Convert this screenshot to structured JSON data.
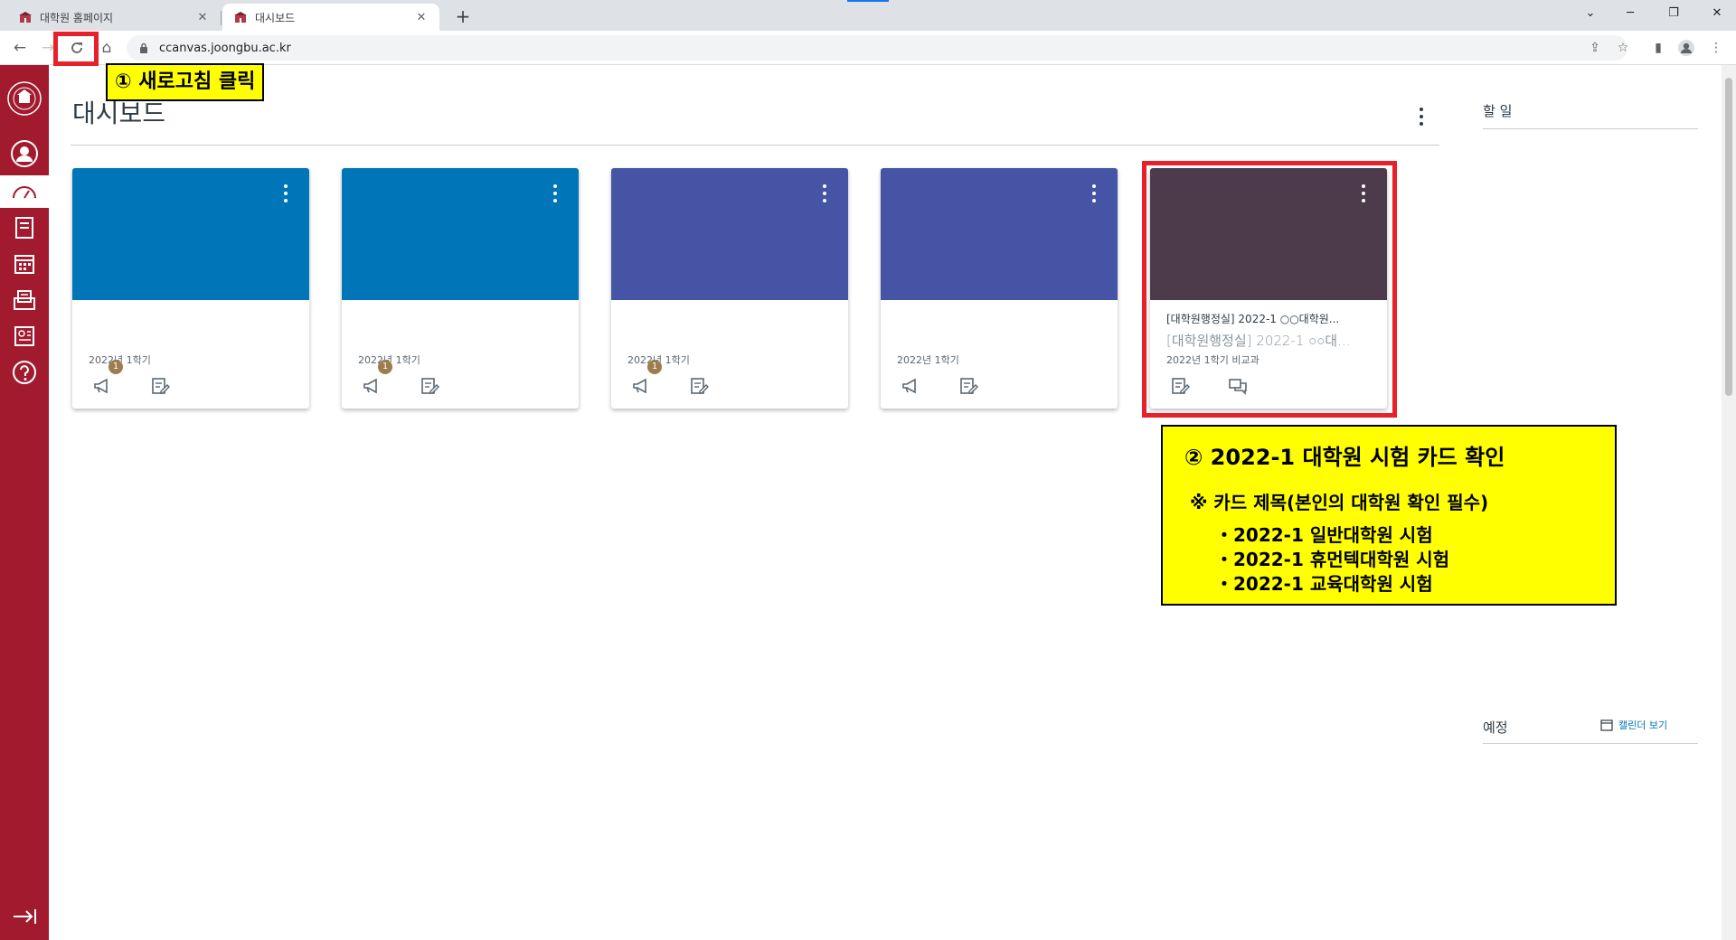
{
  "browser": {
    "tabs": [
      {
        "label": "대학원 홈페이지",
        "active": false
      },
      {
        "label": "대시보드",
        "active": true
      }
    ],
    "new_tab_label": "+",
    "close_label": "✕",
    "url": "ccanvas.joongbu.ac.kr"
  },
  "colors": {
    "nav_bg": "#a11a2e",
    "card_blue": "#0076b8",
    "card_indigo": "#4554a4",
    "card_plum": "#4d3b4b",
    "highlight_red": "#e8202a",
    "note_yellow": "#ffff00",
    "badge": "#9d7d4f"
  },
  "global_nav": {
    "items": [
      {
        "name": "account",
        "icon": "user-icon"
      },
      {
        "name": "dashboard",
        "icon": "dashboard-icon",
        "active": true
      },
      {
        "name": "courses",
        "icon": "book-icon"
      },
      {
        "name": "calendar",
        "icon": "calendar-icon"
      },
      {
        "name": "inbox",
        "icon": "inbox-icon"
      },
      {
        "name": "commons",
        "icon": "commons-icon"
      },
      {
        "name": "help",
        "icon": "help-icon"
      }
    ],
    "collapse_icon": "collapse-icon"
  },
  "dashboard": {
    "title": "대시보드",
    "cards": [
      {
        "color": "#0076b8",
        "title": "",
        "subtitle": "",
        "term": "2022년 1학기",
        "badge": "1",
        "icons": [
          "announcement-icon",
          "assignment-icon"
        ]
      },
      {
        "color": "#0076b8",
        "title": "",
        "subtitle": "",
        "term": "2022년 1학기",
        "badge": "1",
        "icons": [
          "announcement-icon",
          "assignment-icon"
        ]
      },
      {
        "color": "#4554a4",
        "title": "",
        "subtitle": "",
        "term": "2022년 1학기",
        "badge": "1",
        "icons": [
          "announcement-icon",
          "assignment-icon"
        ]
      },
      {
        "color": "#4554a4",
        "title": "",
        "subtitle": "",
        "term": "2022년 1학기",
        "badge": "",
        "icons": [
          "announcement-icon",
          "assignment-icon"
        ]
      },
      {
        "color": "#4d3b4b",
        "title": "[대학원행정실] 2022-1 ○○대학원...",
        "subtitle": "[대학원행정실] 2022-1 ○○대...",
        "term": "2022년 1학기 비교과",
        "badge": "",
        "icons": [
          "assignment-icon",
          "discussion-icon"
        ]
      }
    ]
  },
  "sidebar": {
    "todo_title": "할 일",
    "coming_up_title": "예정",
    "calendar_link": "캘린더 보기"
  },
  "annotations": {
    "step1": "① 새로고침 클릭",
    "step2_heading": "② 2022-1 대학원 시험 카드 확인",
    "step2_subheading": "※ 카드 제목(본인의 대학원 확인 필수)",
    "step2_bullets": [
      "・2022-1 일반대학원 시험",
      "・2022-1 휴먼텍대학원 시험",
      "・2022-1 교육대학원 시험"
    ]
  }
}
